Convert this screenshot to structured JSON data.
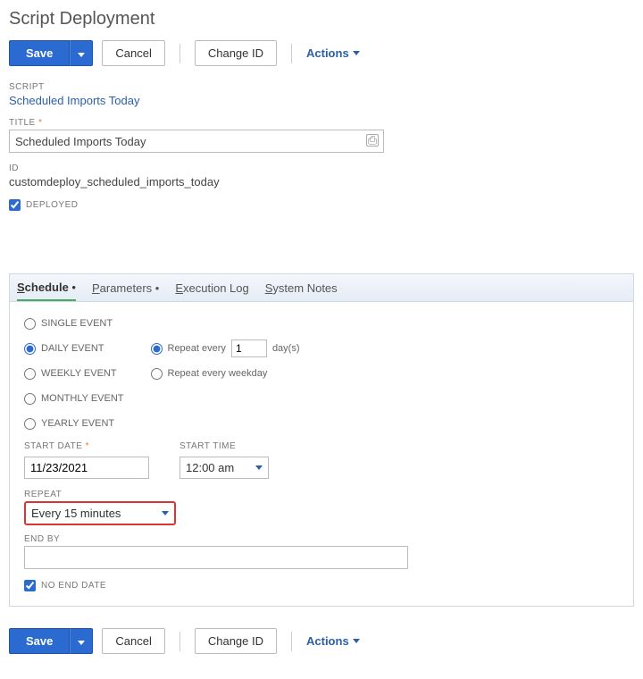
{
  "page_title": "Script Deployment",
  "toolbar": {
    "save": "Save",
    "cancel": "Cancel",
    "change_id": "Change ID",
    "actions": "Actions"
  },
  "fields": {
    "script_label": "SCRIPT",
    "script_link": "Scheduled Imports Today",
    "title_label": "TITLE",
    "title_value": "Scheduled Imports Today",
    "id_label": "ID",
    "id_value": "customdeploy_scheduled_imports_today",
    "deployed_label": "DEPLOYED",
    "deployed_checked": true
  },
  "tabs": {
    "schedule": "Schedule",
    "parameters": "Parameters",
    "execution_log": "Execution Log",
    "system_notes": "System Notes"
  },
  "schedule": {
    "event_options": {
      "single": "SINGLE EVENT",
      "daily": "DAILY EVENT",
      "weekly": "WEEKLY EVENT",
      "monthly": "MONTHLY EVENT",
      "yearly": "YEARLY EVENT",
      "selected": "daily"
    },
    "repeat_every_label_pre": "Repeat every",
    "repeat_every_value": "1",
    "repeat_every_label_post": "day(s)",
    "repeat_weekday_label": "Repeat every weekday",
    "start_date_label": "START DATE",
    "start_date_value": "11/23/2021",
    "start_time_label": "START TIME",
    "start_time_value": "12:00 am",
    "repeat_label": "REPEAT",
    "repeat_value": "Every 15 minutes",
    "end_by_label": "END BY",
    "end_by_value": "",
    "no_end_date_label": "NO END DATE",
    "no_end_date_checked": true
  }
}
